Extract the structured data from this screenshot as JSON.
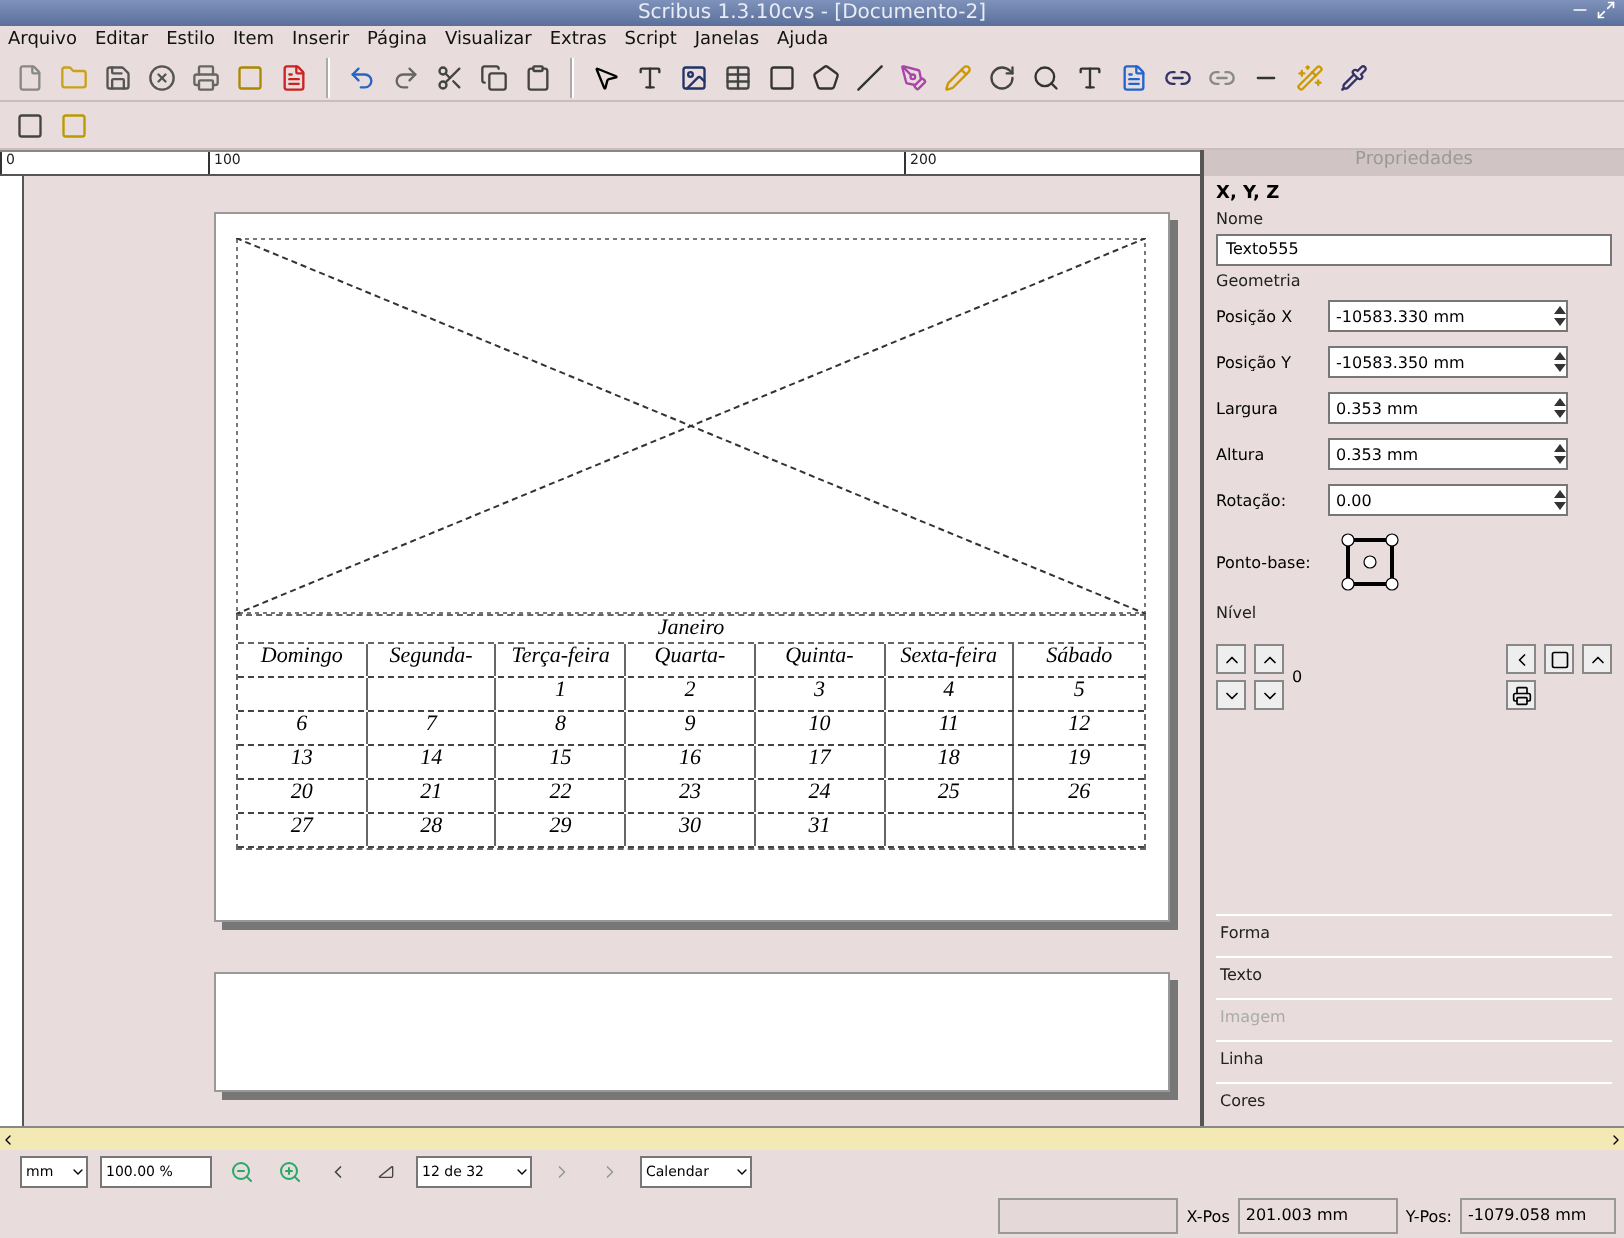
{
  "window": {
    "title": "Scribus 1.3.10cvs - [Documento-2]"
  },
  "menu": [
    "Arquivo",
    "Editar",
    "Estilo",
    "Item",
    "Inserir",
    "Página",
    "Visualizar",
    "Extras",
    "Script",
    "Janelas",
    "Ajuda"
  ],
  "ruler": {
    "labels": [
      "0",
      "100",
      "200"
    ]
  },
  "calendar": {
    "month": "Janeiro",
    "weekdays": [
      "Domingo",
      "Segunda-",
      "Terça-feira",
      "Quarta-",
      "Quinta-",
      "Sexta-feira",
      "Sábado"
    ],
    "rows": [
      [
        null,
        null,
        "1",
        "2",
        "3",
        "4",
        "5"
      ],
      [
        "6",
        "7",
        "8",
        "9",
        "10",
        "11",
        "12"
      ],
      [
        "13",
        "14",
        "15",
        "16",
        "17",
        "18",
        "19"
      ],
      [
        "20",
        "21",
        "22",
        "23",
        "24",
        "25",
        "26"
      ],
      [
        "27",
        "28",
        "29",
        "30",
        "31",
        null,
        null
      ]
    ]
  },
  "properties": {
    "title": "Propriedades",
    "tab": "X, Y, Z",
    "name_group": "Nome",
    "name": "Texto555",
    "geometry_group": "Geometria",
    "fields": [
      {
        "label": "Posição X",
        "value": "-10583.330 mm"
      },
      {
        "label": "Posição Y",
        "value": "-10583.350 mm"
      },
      {
        "label": "Largura",
        "value": "0.353 mm"
      },
      {
        "label": "Altura",
        "value": "0.353 mm"
      },
      {
        "label": "Rotação:",
        "value": "0.00"
      }
    ],
    "basepoint_label": "Ponto-base:",
    "level_group": "Nível",
    "level_value": "0",
    "sections": [
      {
        "label": "Forma",
        "disabled": false
      },
      {
        "label": "Texto",
        "disabled": false
      },
      {
        "label": "Imagem",
        "disabled": true
      },
      {
        "label": "Linha",
        "disabled": false
      },
      {
        "label": "Cores",
        "disabled": false
      }
    ]
  },
  "bottom": {
    "unit": "mm",
    "zoom": "100.00 %",
    "page": "12 de 32",
    "layer": "Calendar"
  },
  "status": {
    "xpos_label": "X-Pos",
    "xpos": "201.003 mm",
    "ypos_label": "Y-Pos:",
    "ypos": "-1079.058 mm"
  }
}
